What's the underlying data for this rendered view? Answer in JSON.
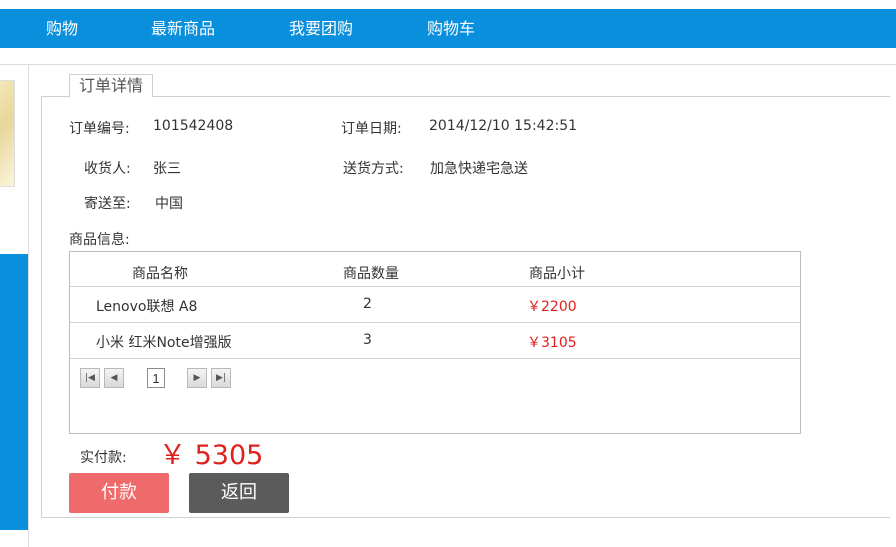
{
  "nav": {
    "items": [
      "购物",
      "最新商品",
      "我要团购",
      "购物车"
    ]
  },
  "panel": {
    "tab_label": "订单详情"
  },
  "order": {
    "number_label": "订单编号:",
    "number": "101542408",
    "date_label": "订单日期:",
    "date": "2014/12/10 15:42:51",
    "receiver_label": "收货人:",
    "receiver": "张三",
    "delivery_label": "送货方式:",
    "delivery": "加急快递宅急送",
    "ship_to_label": "寄送至:",
    "ship_to": "中国",
    "goods_info_label": "商品信息:"
  },
  "goods_table": {
    "headers": [
      "商品名称",
      "商品数量",
      "商品小计"
    ],
    "rows": [
      {
        "name": "Lenovo联想 A8",
        "quantity": "2",
        "subtotal": "￥2200"
      },
      {
        "name": "小米 红米Note增强版",
        "quantity": "3",
        "subtotal": "￥3105"
      }
    ],
    "pager": {
      "current_page": "1"
    }
  },
  "total": {
    "label": "实付款:",
    "amount": "￥ 5305"
  },
  "buttons": {
    "pay": "付款",
    "back": "返回"
  },
  "colors": {
    "nav_blue": "#0a8fdc",
    "price_red": "#e0201d",
    "pay_button": "#ef6b6b",
    "back_button": "#5b5b5b"
  },
  "icons": {
    "first_page": "first-page-icon",
    "prev_page": "prev-page-icon",
    "next_page": "next-page-icon",
    "last_page": "last-page-icon"
  }
}
